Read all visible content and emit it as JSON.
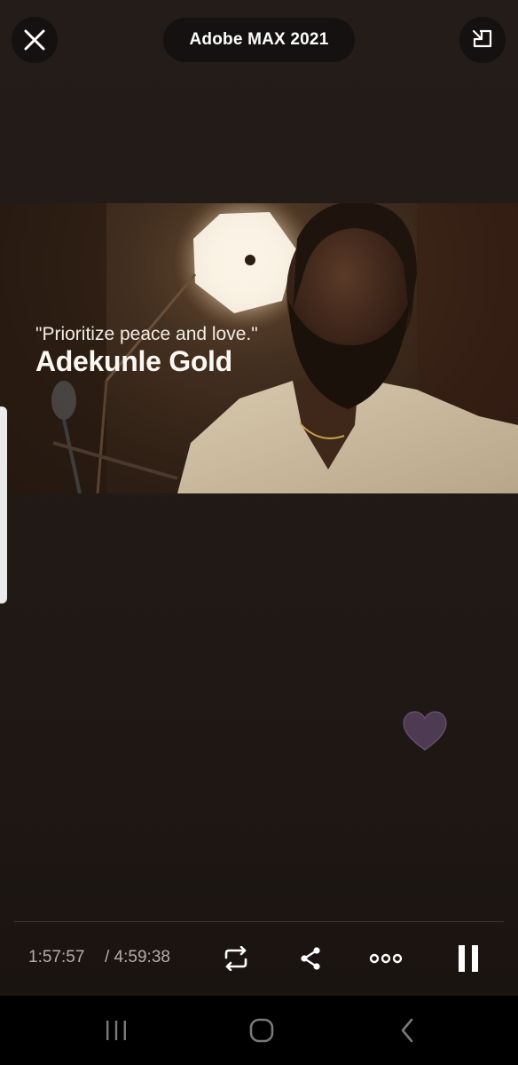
{
  "header": {
    "title": "Adobe MAX 2021",
    "close_icon": "close-icon",
    "pip_icon": "picture-in-picture-icon"
  },
  "video": {
    "quote": "\"Prioritize peace and love.\"",
    "speaker": "Adekunle Gold"
  },
  "reaction": {
    "icon": "heart-icon",
    "color": "#4f3a54"
  },
  "player": {
    "current_time": "1:57:57",
    "total_time": "/ 4:59:38",
    "controls": [
      "repeat-icon",
      "share-icon",
      "more-icon",
      "pause-icon"
    ]
  },
  "navigation": {
    "items": [
      "recent-apps-icon",
      "home-icon",
      "back-icon"
    ]
  },
  "colors": {
    "background": "#1c1714",
    "pill": "#141110",
    "time_text": "#b4aea8"
  }
}
